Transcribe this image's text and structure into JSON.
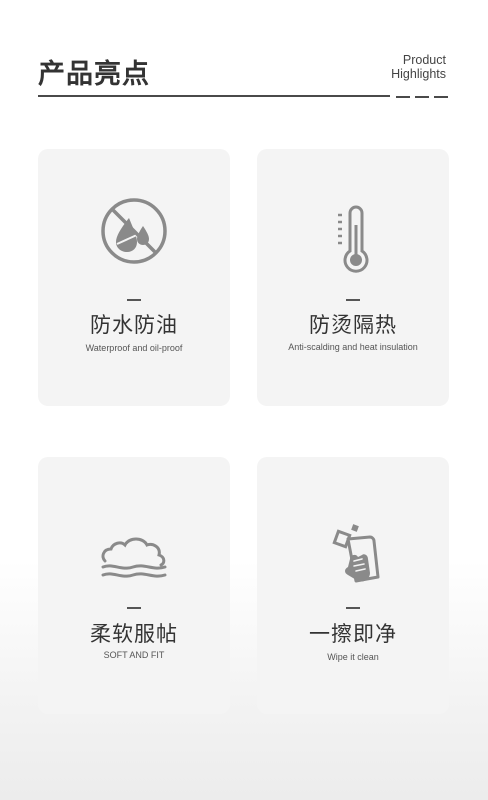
{
  "header": {
    "title_cn": "产品亮点",
    "title_en_line1": "Product",
    "title_en_line2": "Highlights"
  },
  "features": [
    {
      "title": "防水防油",
      "subtitle": "Waterproof and oil-proof",
      "icon": "no-water-drop-icon"
    },
    {
      "title": "防烫隔热",
      "subtitle": "Anti-scalding and heat insulation",
      "icon": "thermometer-icon"
    },
    {
      "title": "柔软服帖",
      "subtitle": "SOFT AND FIT",
      "icon": "cloud-icon"
    },
    {
      "title": "一擦即净",
      "subtitle": "Wipe it clean",
      "icon": "hand-wipe-icon"
    }
  ],
  "colors": {
    "text": "#333333",
    "icon": "#8a8a8a",
    "card_bg": "#f4f4f4",
    "rule": "#4a4a4a"
  }
}
